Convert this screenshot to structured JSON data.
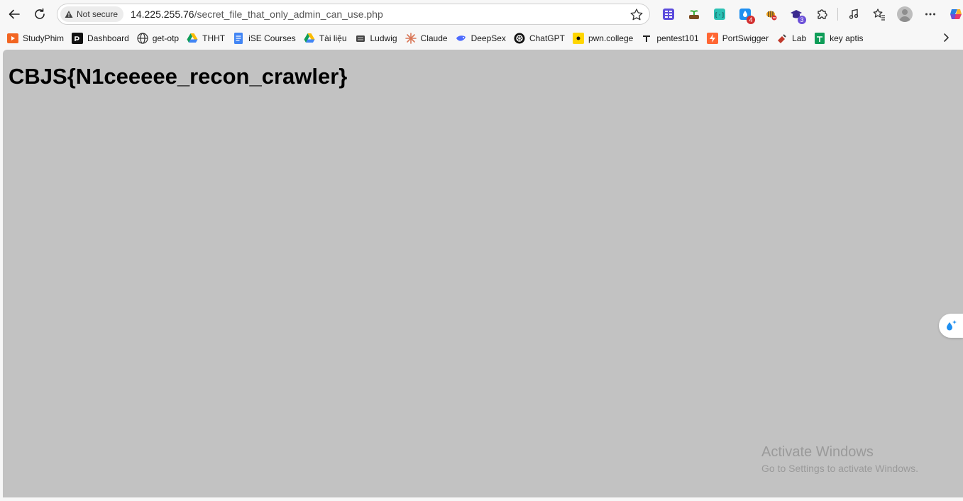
{
  "browser": {
    "security_label": "Not secure",
    "url_host": "14.225.255.76",
    "url_path": "/secret_file_that_only_admin_can_use.php",
    "extension_badges": {
      "ext4": "4",
      "ext7": "3"
    }
  },
  "bookmarks": [
    {
      "label": "StudyPhim",
      "icon": "studyphim-icon"
    },
    {
      "label": "Dashboard",
      "icon": "dashboard-icon"
    },
    {
      "label": "get-otp",
      "icon": "globe-icon"
    },
    {
      "label": "THHT",
      "icon": "google-drive-icon"
    },
    {
      "label": "iSE Courses",
      "icon": "docs-icon"
    },
    {
      "label": "Tài liệu",
      "icon": "google-drive-icon"
    },
    {
      "label": "Ludwig",
      "icon": "ludwig-icon"
    },
    {
      "label": "Claude",
      "icon": "claude-icon"
    },
    {
      "label": "DeepSex",
      "icon": "deepseek-icon"
    },
    {
      "label": "ChatGPT",
      "icon": "chatgpt-icon"
    },
    {
      "label": "pwn.college",
      "icon": "pwn-college-icon"
    },
    {
      "label": "pentest101",
      "icon": "pentest-icon"
    },
    {
      "label": "PortSwigger",
      "icon": "portswigger-icon"
    },
    {
      "label": "Lab",
      "icon": "lab-icon"
    },
    {
      "label": "key aptis",
      "icon": "sheets-icon"
    }
  ],
  "page": {
    "heading": "CBJS{N1ceeeee_recon_crawler}"
  },
  "watermark": {
    "title": "Activate Windows",
    "subtitle": "Go to Settings to activate Windows."
  }
}
